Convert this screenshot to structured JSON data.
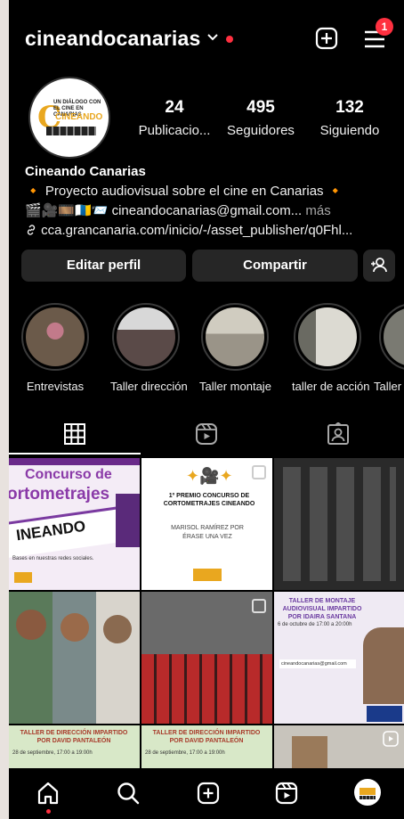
{
  "header": {
    "username": "cineandocanarias",
    "notification_count": "1"
  },
  "profile": {
    "stats": [
      {
        "value": "24",
        "label": "Publicacio..."
      },
      {
        "value": "495",
        "label": "Seguidores"
      },
      {
        "value": "132",
        "label": "Siguiendo"
      }
    ],
    "avatar_text": {
      "line1": "UN DIÁLOGO CON EL CINE EN CANARIAS",
      "brand": "CINEANDO"
    },
    "name": "Cineando Canarias",
    "bio_line1": "Proyecto audiovisual sobre el cine en Canarias",
    "bio_line2_emoji": "🎬🎥🎞️🇮🇨📨",
    "bio_line2_text": "cineandocanarias@gmail.com...",
    "bio_more": "más",
    "link": "cca.grancanaria.com/inicio/-/asset_publisher/q0Fhl..."
  },
  "actions": {
    "edit": "Editar perfil",
    "share": "Compartir"
  },
  "highlights": [
    {
      "label": "Entrevistas",
      "color": "#6b5a4a"
    },
    {
      "label": "Taller dirección",
      "color": "#5a4a48"
    },
    {
      "label": "Taller montaje",
      "color": "#9a9488"
    },
    {
      "label": "taller de acción",
      "color": "#b8b4a8"
    },
    {
      "label": "Taller",
      "color": "#7a7a72"
    }
  ],
  "posts": [
    {
      "title": "Concurso de",
      "subtitle": "ortometrajes",
      "brand": "INEANDO",
      "note": "Bases en nuestras redes sociales.",
      "bg": "#f4ecf6"
    },
    {
      "title": "1º PREMIO CONCURSO DE CORTOMETRAJES CINEANDO",
      "subtitle": "MARISOL RAMÍREZ POR ÉRASE UNA VEZ",
      "bg": "#ffffff"
    },
    {
      "title": "",
      "bg": "#2a2a2a"
    },
    {
      "title": "",
      "bg": "#3a4a52"
    },
    {
      "title": "",
      "bg": "#4a3428"
    },
    {
      "title": "TALLER DE MONTAJE AUDIOVISUAL IMPARTIDO POR IDAIRA SANTANA",
      "subtitle": "6 de octubre de 17:00 a 20:00h",
      "email": "cineandocanarias@gmail.com",
      "bg": "#efeaf3"
    },
    {
      "title": "TALLER DE DIRECCIÓN IMPARTIDO POR DAVID PANTALEÓN",
      "subtitle": "28 de septiembre, 17:00 a 19:00h",
      "bg": "#d8e8c8"
    },
    {
      "title": "TALLER DE DIRECCIÓN IMPARTIDO POR DAVID PANTALEÓN",
      "subtitle": "28 de septiembre, 17:00 a 19:00h",
      "bg": "#d8e8c8"
    },
    {
      "title": "",
      "bg": "#c8c4bc"
    }
  ]
}
